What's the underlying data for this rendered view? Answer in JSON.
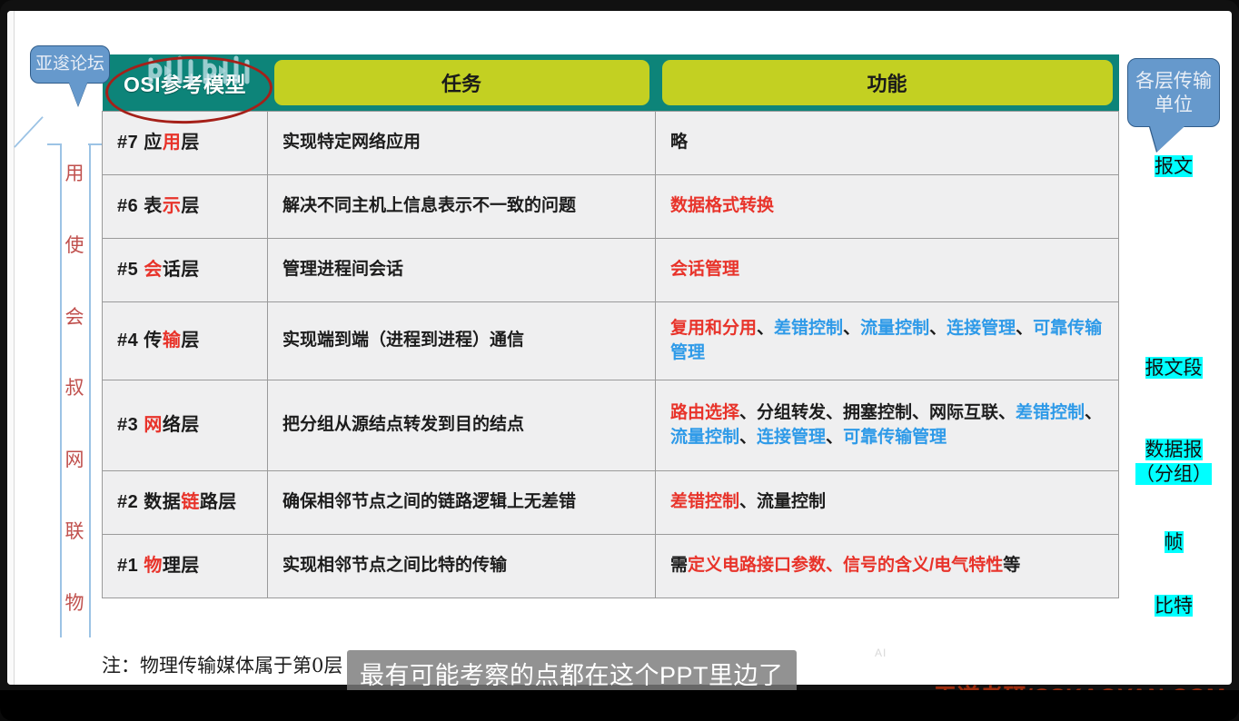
{
  "player": {
    "subtitle": "最有可能考察的点都在这个PPT里边了",
    "ai_mark": "AI",
    "watermark": "王道考研/CSKAOYAN.COM",
    "logo_text": "bilibili"
  },
  "callouts": {
    "left": "亚逡论坛",
    "right": "各层传输单位"
  },
  "mnemonic": {
    "chars": [
      "用",
      "使",
      "会",
      "叔",
      "网",
      "联",
      "物"
    ]
  },
  "table": {
    "header": {
      "col1": "OSI参考模型",
      "col2": "任务",
      "col3": "功能"
    },
    "rows": [
      {
        "layer_pre": "#7 应",
        "layer_hl": "用",
        "layer_post": "层",
        "task": "实现特定网络应用",
        "func": [
          {
            "text": "略",
            "color": "black"
          }
        ],
        "pdu": "报文"
      },
      {
        "layer_pre": "#6 表",
        "layer_hl": "示",
        "layer_post": "层",
        "task": "解决不同主机上信息表示不一致的问题",
        "func": [
          {
            "text": "数据格式转换",
            "color": "red"
          }
        ],
        "pdu": ""
      },
      {
        "layer_pre": "#5 ",
        "layer_hl": "会",
        "layer_post": "话层",
        "task": "管理进程间会话",
        "func": [
          {
            "text": "会话管理",
            "color": "red"
          }
        ],
        "pdu": ""
      },
      {
        "layer_pre": "#4 传",
        "layer_hl": "输",
        "layer_post": "层",
        "task": "实现端到端（进程到进程）通信",
        "func": [
          {
            "text": "复用和分用",
            "color": "red"
          },
          {
            "text": "、",
            "color": "black"
          },
          {
            "text": "差错控制",
            "color": "blue"
          },
          {
            "text": "、",
            "color": "black"
          },
          {
            "text": "流量控制",
            "color": "blue"
          },
          {
            "text": "、",
            "color": "black"
          },
          {
            "text": "连接管理",
            "color": "blue"
          },
          {
            "text": "、",
            "color": "black"
          },
          {
            "text": "可靠传输管理",
            "color": "blue"
          }
        ],
        "pdu": "报文段"
      },
      {
        "layer_pre": "#3 ",
        "layer_hl": "网",
        "layer_post": "络层",
        "task": "把分组从源结点转发到目的结点",
        "func": [
          {
            "text": "路由选择",
            "color": "red"
          },
          {
            "text": "、分组转发、拥塞控制、网际互联、",
            "color": "black"
          },
          {
            "text": "差错控制",
            "color": "blue"
          },
          {
            "text": "、",
            "color": "black"
          },
          {
            "text": "流量控制",
            "color": "blue"
          },
          {
            "text": "、",
            "color": "black"
          },
          {
            "text": "连接管理",
            "color": "blue"
          },
          {
            "text": "、",
            "color": "black"
          },
          {
            "text": "可靠传输管理",
            "color": "blue"
          }
        ],
        "pdu": "数据报\n（分组）"
      },
      {
        "layer_pre": "#2 数据",
        "layer_hl": "链",
        "layer_post": "路层",
        "task": "确保相邻节点之间的链路逻辑上无差错",
        "func": [
          {
            "text": "差错控制",
            "color": "red"
          },
          {
            "text": "、流量控制",
            "color": "black"
          }
        ],
        "pdu": "帧"
      },
      {
        "layer_pre": "#1 ",
        "layer_hl": "物",
        "layer_post": "理层",
        "task": "实现相邻节点之间比特的传输",
        "func": [
          {
            "text": "需",
            "color": "black"
          },
          {
            "text": "定义电路接口参数、信号的含义/电气特性",
            "color": "red"
          },
          {
            "text": "等",
            "color": "black"
          }
        ],
        "pdu": "比特"
      }
    ]
  },
  "note": "注：物理传输媒体属于第0层",
  "colors": {
    "header_teal": "#0d8479",
    "header_chip": "#c3d022",
    "cell_bg": "#efeff0",
    "red": "#e8332a",
    "blue": "#2e9ae8",
    "callout_blue": "#6699cc",
    "highlight_cyan": "#00ffff",
    "mnemonic_red": "#c0504d",
    "watermark": "#9b2b0c"
  }
}
